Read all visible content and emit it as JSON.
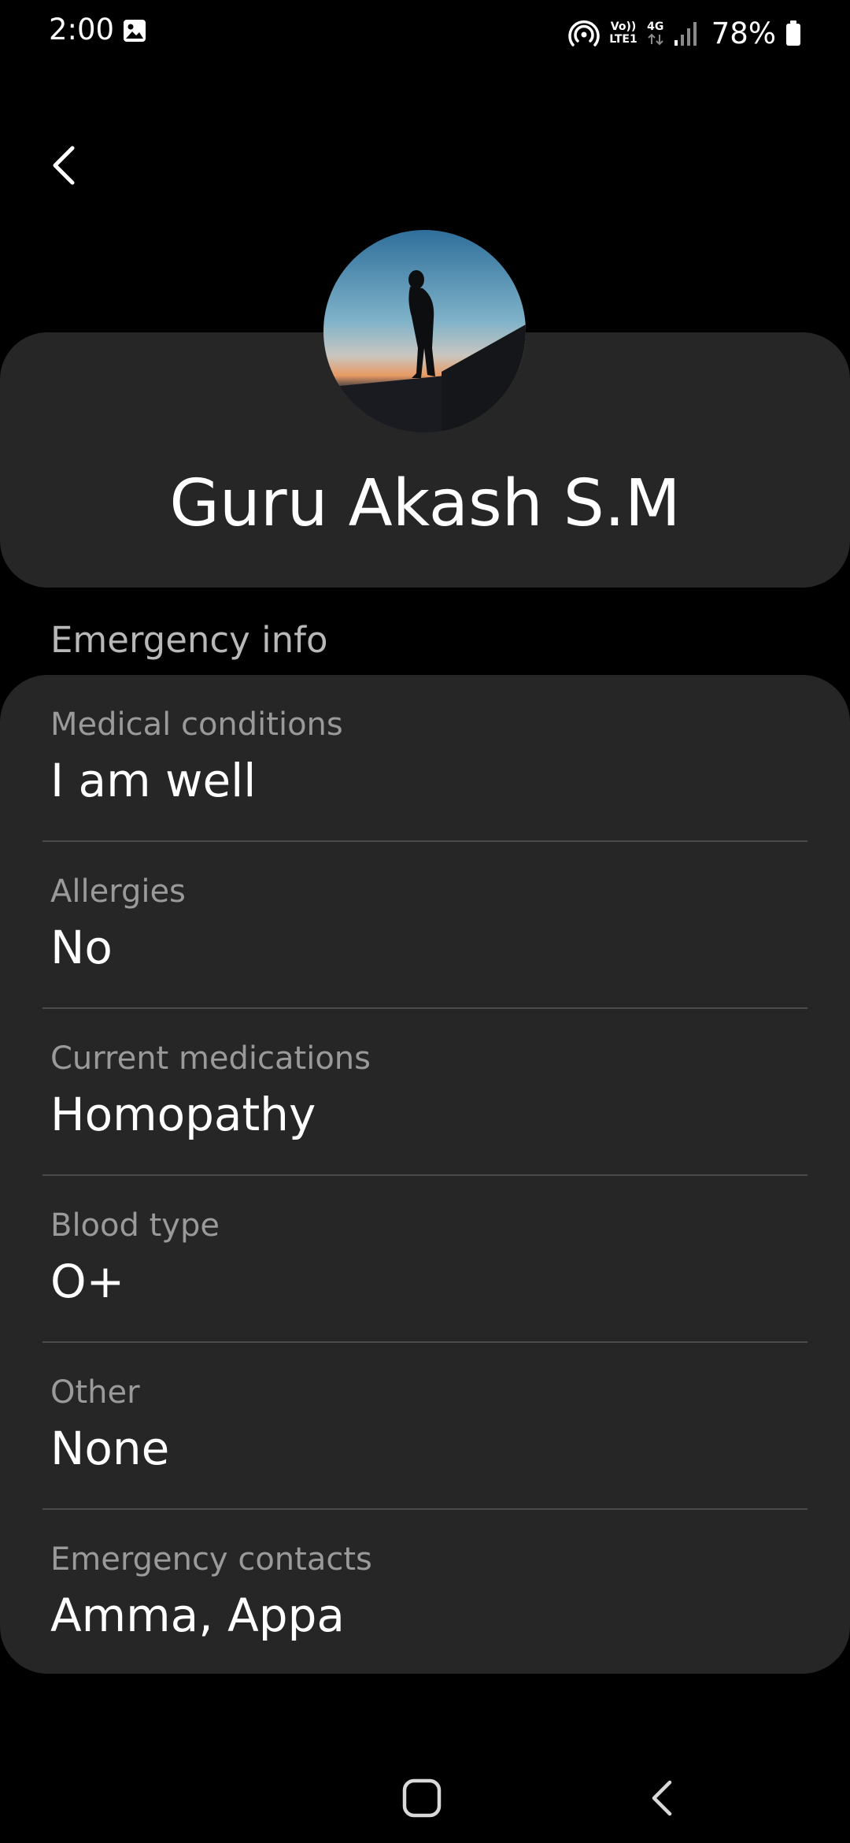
{
  "status_bar": {
    "time": "2:00",
    "battery": "78%",
    "network_type": "4G",
    "volte_line1": "Vo))",
    "volte_line2": "LTE1",
    "icons": [
      "gallery-icon",
      "hotspot-icon",
      "volte-icon",
      "network-4g-icon",
      "signal-icon",
      "battery-icon"
    ]
  },
  "header": {
    "back_icon": "chevron-left-icon"
  },
  "profile": {
    "name": "Guru Akash S.M",
    "avatar": "silhouette-at-sunset-photo"
  },
  "emergency": {
    "section_title": "Emergency info",
    "items": [
      {
        "label": "Medical conditions",
        "value": "I am well"
      },
      {
        "label": "Allergies",
        "value": "No"
      },
      {
        "label": "Current medications",
        "value": "Homopathy"
      },
      {
        "label": "Blood type",
        "value": "O+"
      },
      {
        "label": "Other",
        "value": "None"
      },
      {
        "label": "Emergency contacts",
        "value": "Amma, Appa"
      }
    ]
  },
  "nav_bar": {
    "home_icon": "home-square-icon",
    "back_icon": "nav-back-icon"
  },
  "colors": {
    "background": "#000000",
    "card": "#262626",
    "label": "#9a9a9a",
    "section_label": "#b8b8b8",
    "value": "#ffffff",
    "divider": "#4a4a4a"
  }
}
